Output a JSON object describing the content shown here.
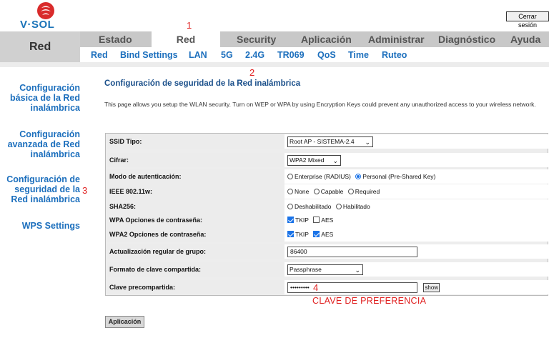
{
  "brand": {
    "logo_text": "V·SOL",
    "logo_icon": "vsol-logo-icon"
  },
  "header": {
    "logout_label": "Cerrar sesión"
  },
  "section_title": "Red",
  "tabs": [
    {
      "label": "Estado",
      "active": false
    },
    {
      "label": "Red",
      "active": true
    },
    {
      "label": "Security",
      "active": false
    },
    {
      "label": "Aplicación",
      "active": false
    },
    {
      "label": "Administrar",
      "active": false
    },
    {
      "label": "Diagnóstico",
      "active": false
    },
    {
      "label": "Ayuda",
      "active": false
    }
  ],
  "subtabs": [
    "Red",
    "Bind Settings",
    "LAN",
    "5G",
    "2.4G",
    "TR069",
    "QoS",
    "Time",
    "Ruteo"
  ],
  "sidebar": {
    "items": [
      {
        "line1": "Configuración",
        "line2": "básica de la Red",
        "line3": "inalámbrica"
      },
      {
        "line1": "Configuración",
        "line2": "avanzada de Red",
        "line3": "inalámbrica"
      },
      {
        "line1": "Configuración de",
        "line2": "seguridad de la",
        "line3": "Red inalámbrica"
      },
      {
        "line1": "WPS Settings"
      }
    ]
  },
  "page": {
    "heading": "Configuración de seguridad de la Red inalámbrica",
    "description": "This page allows you setup the WLAN security. Turn on WEP or WPA by using Encryption Keys could prevent any unauthorized access to your wireless network."
  },
  "form": {
    "ssid_type": {
      "label": "SSID Tipo:",
      "value": "Root AP - SISTEMA-2.4"
    },
    "cipher": {
      "label": "Cifrar:",
      "value": "WPA2 Mixed"
    },
    "auth_mode": {
      "label": "Modo de autenticación:",
      "opt1": "Enterprise (RADIUS)",
      "opt2": "Personal (Pre-Shared Key)",
      "selected": "Personal (Pre-Shared Key)"
    },
    "ieee80211w": {
      "label": "IEEE 802.11w:",
      "opt1": "None",
      "opt2": "Capable",
      "opt3": "Required",
      "selected": "none"
    },
    "sha256": {
      "label": "SHA256:",
      "opt1": "Deshabilitado",
      "opt2": "Habilitado",
      "selected": "none"
    },
    "wpa_opts": {
      "label": "WPA Opciones de contraseña:",
      "tkip": "TKIP",
      "aes": "AES",
      "tkip_checked": true,
      "aes_checked": false
    },
    "wpa2_opts": {
      "label": "WPA2 Opciones de contraseña:",
      "tkip": "TKIP",
      "aes": "AES",
      "tkip_checked": true,
      "aes_checked": true
    },
    "group_update": {
      "label": "Actualización regular de grupo:",
      "value": "86400"
    },
    "psk_format": {
      "label": "Formato de clave compartida:",
      "value": "Passphrase"
    },
    "psk": {
      "label": "Clave precompartida:",
      "value": "•••••••••",
      "show_label": "show"
    }
  },
  "apply_label": "Aplicación",
  "annotations": {
    "n1": "1",
    "n2": "2",
    "n3": "3",
    "n4": "4",
    "note": "CLAVE DE PREFERENCIA"
  },
  "colors": {
    "link_blue": "#1c6fbd",
    "heading_blue": "#1a4f8a",
    "annotation_red": "#e02020",
    "nav_gray": "#d6d6d6"
  }
}
